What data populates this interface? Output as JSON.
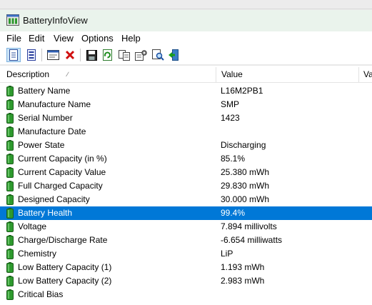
{
  "window": {
    "title": "BatteryInfoView"
  },
  "menu": [
    "File",
    "Edit",
    "View",
    "Options",
    "Help"
  ],
  "toolbar": {
    "buttons": [
      "html-report-icon",
      "report-icon",
      "properties-window-icon",
      "delete-icon",
      "save-icon",
      "refresh-icon",
      "copy-icon",
      "options-icon",
      "find-icon",
      "exit-icon"
    ]
  },
  "columns": {
    "description": "Description",
    "value": "Value",
    "extra": "Va"
  },
  "rows": [
    {
      "description": "Battery Name",
      "value": "L16M2PB1"
    },
    {
      "description": "Manufacture Name",
      "value": "SMP"
    },
    {
      "description": "Serial Number",
      "value": " 1423"
    },
    {
      "description": "Manufacture Date",
      "value": ""
    },
    {
      "description": "Power State",
      "value": "Discharging"
    },
    {
      "description": "Current Capacity (in %)",
      "value": "85.1%"
    },
    {
      "description": "Current Capacity Value",
      "value": "25.380 mWh"
    },
    {
      "description": "Full Charged Capacity",
      "value": "29.830 mWh"
    },
    {
      "description": "Designed Capacity",
      "value": "30.000 mWh"
    },
    {
      "description": "Battery Health",
      "value": "99.4%"
    },
    {
      "description": "Voltage",
      "value": "7.894 millivolts"
    },
    {
      "description": "Charge/Discharge Rate",
      "value": "-6.654 milliwatts"
    },
    {
      "description": "Chemistry",
      "value": "LiP"
    },
    {
      "description": "Low Battery Capacity (1)",
      "value": "1.193 mWh"
    },
    {
      "description": "Low Battery Capacity (2)",
      "value": "2.983 mWh"
    },
    {
      "description": "Critical Bias",
      "value": ""
    }
  ],
  "selected_row": "Battery Health",
  "colors": {
    "selection": "#0078d7",
    "titlebar": "#eaf3ec",
    "battery": "#2e9a2e"
  }
}
